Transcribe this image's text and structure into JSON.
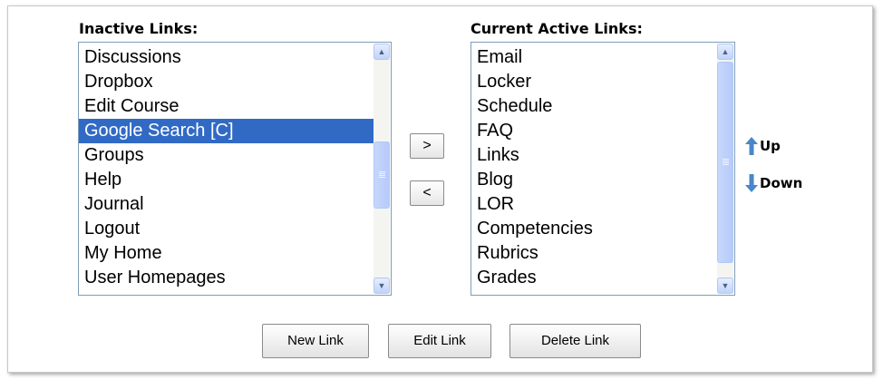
{
  "inactive": {
    "label": "Inactive Links:",
    "items": [
      "Discussions",
      "Dropbox",
      "Edit Course",
      "Google Search [C]",
      "Groups",
      "Help",
      "Journal",
      "Logout",
      "My Home",
      "User Homepages"
    ],
    "selected": "Google Search [C]"
  },
  "active": {
    "label": "Current Active Links:",
    "items": [
      "Email",
      "Locker",
      "Schedule",
      "FAQ",
      "Links",
      "Blog",
      "LOR",
      "Competencies",
      "Rubrics",
      "Grades"
    ]
  },
  "controls": {
    "move_right": ">",
    "move_left": "<",
    "up": "Up",
    "down": "Down"
  },
  "buttons": {
    "new_link": "New Link",
    "edit_link": "Edit Link",
    "delete_link": "Delete Link"
  },
  "colors": {
    "selection": "#316ac5",
    "arrow": "#4a86c8",
    "listbox_border": "#7f9db9"
  }
}
